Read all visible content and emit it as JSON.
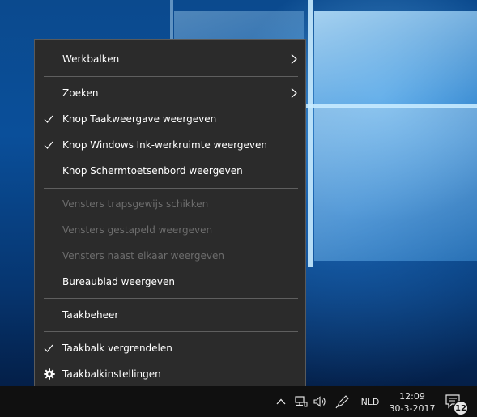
{
  "menu": {
    "items": [
      {
        "label": "Werkbalken",
        "submenu": true,
        "checked": false,
        "enabled": true
      },
      {
        "label": "Zoeken",
        "submenu": true,
        "checked": false,
        "enabled": true
      },
      {
        "label": "Knop Taakweergave weergeven",
        "submenu": false,
        "checked": true,
        "enabled": true
      },
      {
        "label": "Knop Windows Ink-werkruimte weergeven",
        "submenu": false,
        "checked": true,
        "enabled": true
      },
      {
        "label": "Knop Schermtoetsenbord weergeven",
        "submenu": false,
        "checked": false,
        "enabled": true
      },
      {
        "label": "Vensters trapsgewijs schikken",
        "submenu": false,
        "checked": false,
        "enabled": false
      },
      {
        "label": "Vensters gestapeld weergeven",
        "submenu": false,
        "checked": false,
        "enabled": false
      },
      {
        "label": "Vensters naast elkaar weergeven",
        "submenu": false,
        "checked": false,
        "enabled": false
      },
      {
        "label": "Bureaublad weergeven",
        "submenu": false,
        "checked": false,
        "enabled": true
      },
      {
        "label": "Taakbeheer",
        "submenu": false,
        "checked": false,
        "enabled": true
      },
      {
        "label": "Taakbalk vergrendelen",
        "submenu": false,
        "checked": true,
        "enabled": true
      },
      {
        "label": "Taakbalkinstellingen",
        "submenu": false,
        "checked": false,
        "enabled": true,
        "icon": "gear-icon"
      }
    ]
  },
  "taskbar": {
    "language": "NLD",
    "time": "12:09",
    "date": "30-3-2017",
    "notification_count": "12",
    "tray_icons": [
      "chevron-up-icon",
      "network-icon",
      "speaker-icon",
      "windows-ink-pen-icon",
      "action-center-icon"
    ]
  },
  "colors": {
    "menu_background": "#2b2b2b",
    "menu_text": "#ffffff",
    "menu_disabled_text": "#6d6d6d",
    "taskbar_background": "#101010"
  }
}
